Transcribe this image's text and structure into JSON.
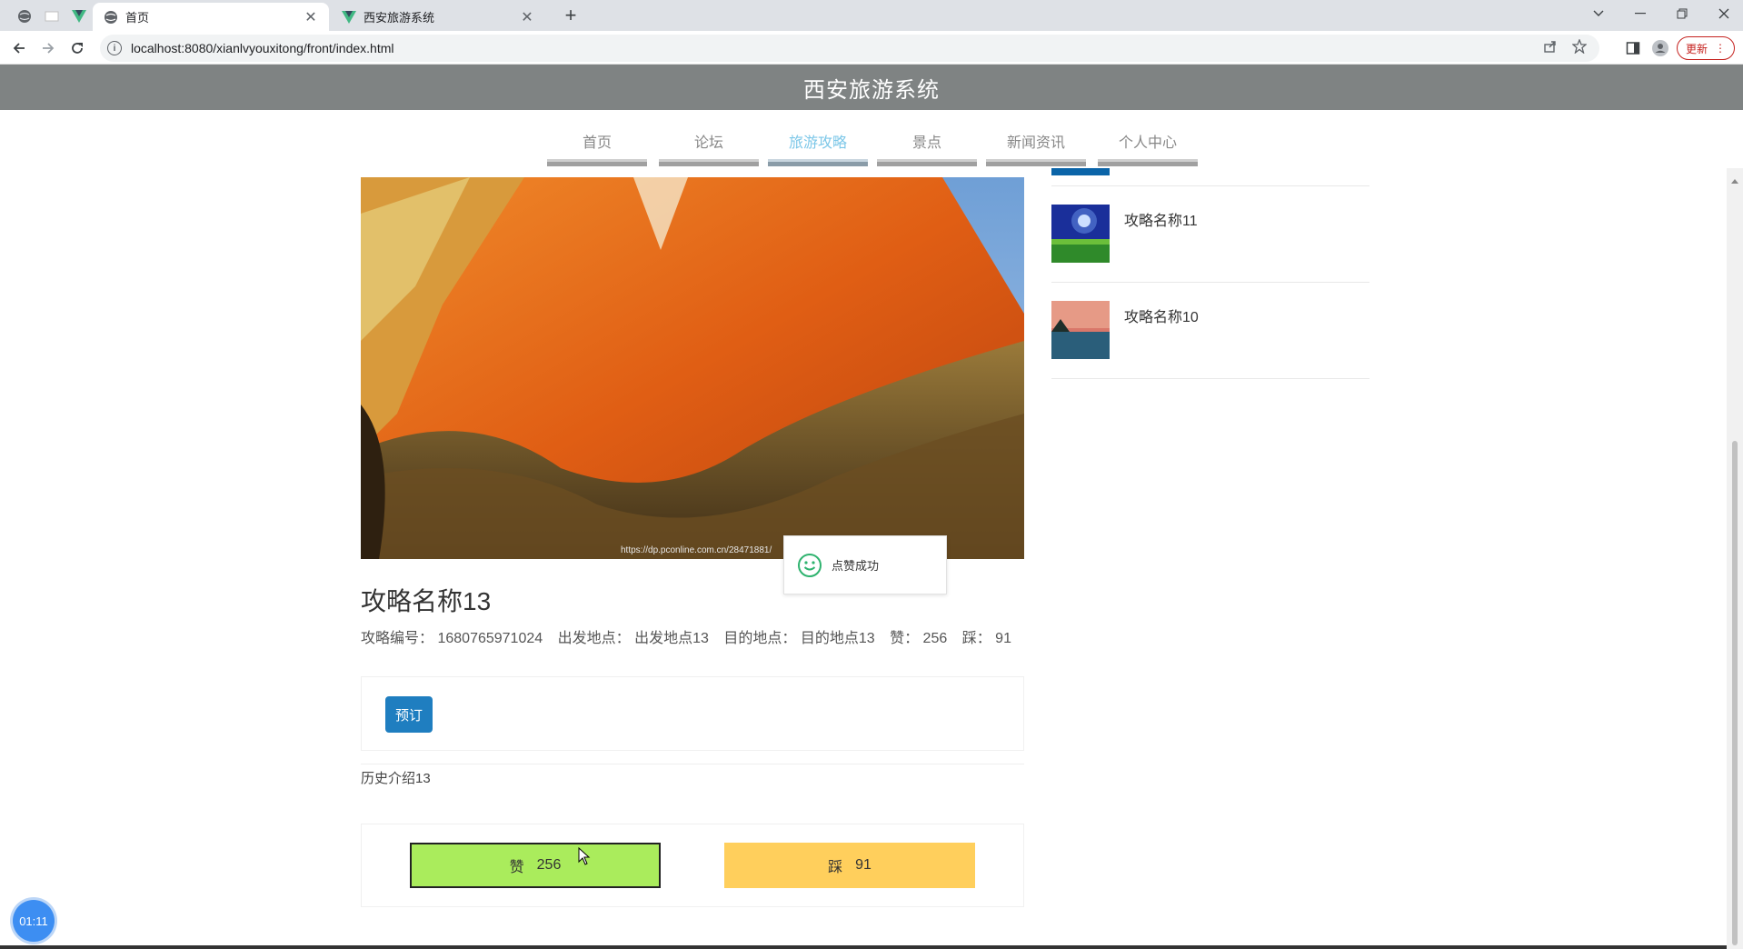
{
  "browser": {
    "tabs": [
      {
        "title": "首页",
        "active": true
      },
      {
        "title": "西安旅游系统",
        "active": false
      }
    ],
    "address": "localhost:8080/xianlvyouxitong/front/index.html",
    "update_label": "更新"
  },
  "site": {
    "title": "西安旅游系统",
    "nav": [
      "首页",
      "论坛",
      "旅游攻略",
      "景点",
      "新闻资讯",
      "个人中心"
    ],
    "active_nav": "旅游攻略"
  },
  "article": {
    "image_credit": "https://dp.pconline.com.cn/28471881/",
    "title": "攻略名称13",
    "meta": {
      "id_label": "攻略编号：",
      "id_value": "1680765971024",
      "from_label": "出发地点：",
      "from_value": "出发地点13",
      "to_label": "目的地点：",
      "to_value": "目的地点13",
      "like_label": "赞：",
      "like_value": "256",
      "dislike_label": "踩：",
      "dislike_value": "91"
    },
    "book_label": "预订",
    "history": "历史介绍13",
    "vote": {
      "like_label": "赞",
      "like_count": "256",
      "dislike_label": "踩",
      "dislike_count": "91"
    }
  },
  "toast": {
    "text": "点赞成功"
  },
  "sidebar": {
    "items": [
      {
        "title": "攻略名称11"
      },
      {
        "title": "攻略名称10"
      }
    ]
  },
  "timer": "01:11",
  "colors": {
    "header_bg": "#7f8383",
    "active_nav": "#7cc7e8",
    "book_button": "#1f7ec0",
    "like_button": "#aaec5c",
    "dislike_button": "#ffcf5c"
  }
}
